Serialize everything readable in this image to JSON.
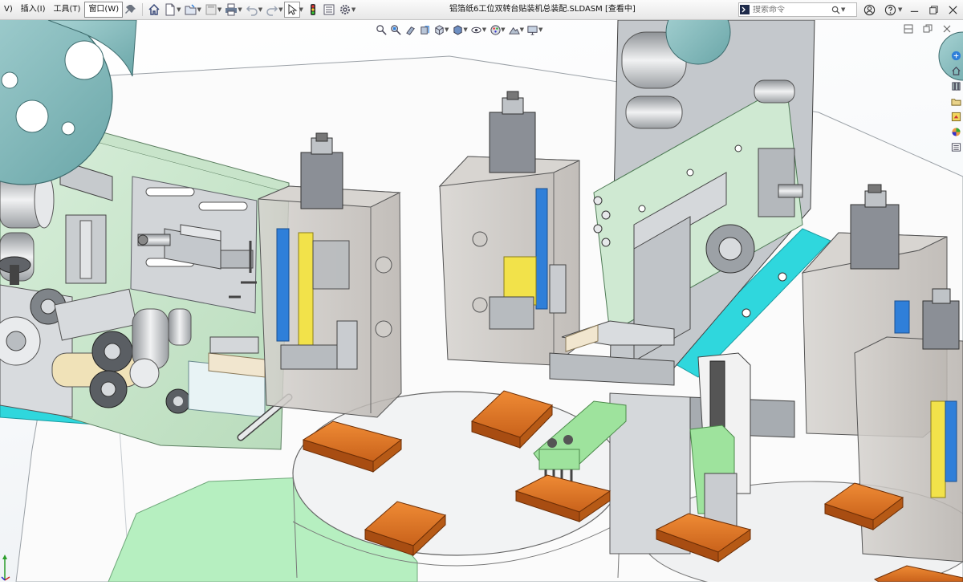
{
  "menu": {
    "items": [
      {
        "label": "V)"
      },
      {
        "label": "插入(I)"
      },
      {
        "label": "工具(T)"
      },
      {
        "label": "窗口(W)",
        "active": true
      }
    ]
  },
  "toolbar": {
    "icons": [
      "pin-icon",
      "home-icon",
      "new-document-icon",
      "open-folder-icon",
      "save-icon",
      "print-icon",
      "undo-icon",
      "redo-icon",
      "select-arrow-icon",
      "traffic-light-icon",
      "options-panel-icon",
      "gear-icon"
    ]
  },
  "document": {
    "title": "铝箔纸6工位双转台贴装机总装配.SLDASM [查看中]"
  },
  "search": {
    "placeholder": "搜索命令"
  },
  "view_toolbar": {
    "icons": [
      "zoom-to-fit-icon",
      "zoom-to-area-icon",
      "previous-view-icon",
      "section-view-icon",
      "view-orientation-icon",
      "display-style-icon",
      "hide-show-icon",
      "edit-appearance-icon",
      "apply-scene-icon",
      "view-settings-icon"
    ]
  },
  "colors": {
    "titlebar_top": "#fbfbfb",
    "titlebar_bottom": "#e7e7e7",
    "viewport_bg": "#f6f8fa",
    "machine_green": "#cfe9d2",
    "plate_orange": "#e07a28",
    "base_cyan": "#2fd7dd",
    "housing_gray": "#c9c5c1",
    "accent_blue": "#2f7fd9",
    "accent_yellow": "#f2e24a",
    "wheel_teal": "#8fc1c3"
  }
}
